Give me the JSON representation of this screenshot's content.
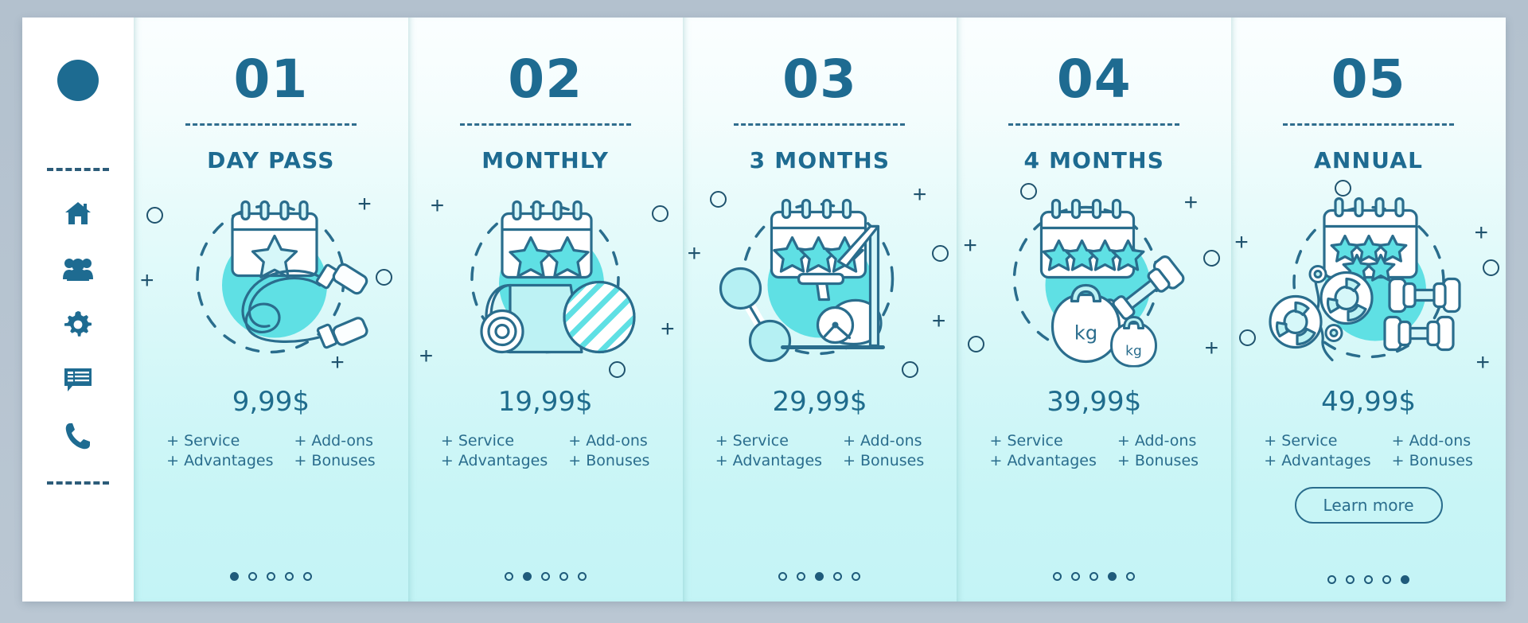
{
  "theme": {
    "page_background": "#b9c6d2",
    "sidebar_background": "#ffffff",
    "accent_dark": "#1e6b91",
    "accent_text": "#2a6d8d",
    "card_gradient_top": "#fbfeff",
    "card_gradient_bottom": "#c4f4f6",
    "illustration_blob": "#5fe0e4"
  },
  "sidebar": {
    "avatar": "avatar-circle",
    "divider_top": "dashed-divider",
    "divider_bottom": "dashed-divider",
    "items": [
      {
        "icon": "home-icon",
        "label": "Home"
      },
      {
        "icon": "users-icon",
        "label": "Community"
      },
      {
        "icon": "gear-icon",
        "label": "Settings"
      },
      {
        "icon": "chat-icon",
        "label": "Messages"
      },
      {
        "icon": "phone-icon",
        "label": "Contact"
      }
    ]
  },
  "cards": [
    {
      "number": "01",
      "title": "DAY PASS",
      "price": "9,99$",
      "features": [
        "+ Service",
        "+ Add-ons",
        "+ Advantages",
        "+ Bonuses"
      ],
      "illustration": "calendar-one-star-jump-rope",
      "stars": 1,
      "dots_total": 5,
      "dots_active_index": 0,
      "cta": null
    },
    {
      "number": "02",
      "title": "MONTHLY",
      "price": "19,99$",
      "features": [
        "+ Service",
        "+ Add-ons",
        "+ Advantages",
        "+ Bonuses"
      ],
      "illustration": "calendar-two-stars-yoga-mat-ball",
      "stars": 2,
      "dots_total": 5,
      "dots_active_index": 1,
      "cta": null
    },
    {
      "number": "03",
      "title": "3 MONTHS",
      "price": "29,99$",
      "features": [
        "+ Service",
        "+ Add-ons",
        "+ Advantages",
        "+ Bonuses"
      ],
      "illustration": "calendar-three-stars-exercise-bike",
      "stars": 3,
      "dots_total": 5,
      "dots_active_index": 2,
      "cta": null
    },
    {
      "number": "04",
      "title": "4 MONTHS",
      "price": "39,99$",
      "features": [
        "+ Service",
        "+ Add-ons",
        "+ Advantages",
        "+ Bonuses"
      ],
      "illustration": "calendar-four-stars-kettlebells-dumbbell",
      "stars": 4,
      "dots_total": 5,
      "dots_active_index": 3,
      "cta": null
    },
    {
      "number": "05",
      "title": "ANNUAL",
      "price": "49,99$",
      "features": [
        "+ Service",
        "+ Add-ons",
        "+ Advantages",
        "+ Bonuses"
      ],
      "illustration": "calendar-five-stars-weight-plates-dumbbells",
      "stars": 5,
      "dots_total": 5,
      "dots_active_index": 4,
      "cta": "Learn more"
    }
  ],
  "illustration_labels": {
    "kettlebell_big": "kg",
    "kettlebell_small": "kg"
  }
}
